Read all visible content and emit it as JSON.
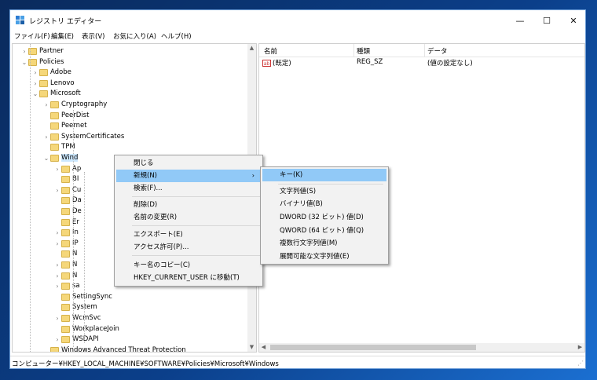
{
  "window": {
    "title": "レジストリ エディター",
    "controls": {
      "minimize": "—",
      "maximize": "☐",
      "close": "✕"
    }
  },
  "menubar": [
    "ファイル(F)",
    "編集(E)",
    "表示(V)",
    "お気に入り(A)",
    "ヘルプ(H)"
  ],
  "tree": [
    {
      "label": "Partner",
      "expander": "›"
    },
    {
      "label": "Policies",
      "expander": "⌄"
    },
    {
      "label": "Adobe",
      "expander": "›"
    },
    {
      "label": "Lenovo",
      "expander": "›"
    },
    {
      "label": "Microsoft",
      "expander": "⌄"
    },
    {
      "label": "Cryptography",
      "expander": "›"
    },
    {
      "label": "PeerDist",
      "expander": ""
    },
    {
      "label": "Peernet",
      "expander": ""
    },
    {
      "label": "SystemCertificates",
      "expander": "›"
    },
    {
      "label": "TPM",
      "expander": ""
    },
    {
      "label": "Wind",
      "expander": "⌄"
    },
    {
      "label": "Ap",
      "expander": "›"
    },
    {
      "label": "BI",
      "expander": ""
    },
    {
      "label": "Cu",
      "expander": "›"
    },
    {
      "label": "Da",
      "expander": ""
    },
    {
      "label": "De",
      "expander": ""
    },
    {
      "label": "Er",
      "expander": ""
    },
    {
      "label": "In",
      "expander": "›"
    },
    {
      "label": "IP",
      "expander": "›"
    },
    {
      "label": "N",
      "expander": ""
    },
    {
      "label": "N",
      "expander": "›"
    },
    {
      "label": "N",
      "expander": "›"
    },
    {
      "label": "sa",
      "expander": "›"
    },
    {
      "label": "SettingSync",
      "expander": ""
    },
    {
      "label": "System",
      "expander": ""
    },
    {
      "label": "WcmSvc",
      "expander": "›"
    },
    {
      "label": "WorkplaceJoin",
      "expander": ""
    },
    {
      "label": "WSDAPI",
      "expander": "›"
    },
    {
      "label": "Windows Advanced Threat Protection",
      "expander": ""
    }
  ],
  "list": {
    "headers": {
      "name": "名前",
      "type": "種類",
      "data": "データ"
    },
    "rows": [
      {
        "icon": "ab",
        "name": "(既定)",
        "type": "REG_SZ",
        "data": "(値の設定なし)"
      }
    ]
  },
  "status": "コンピューター¥HKEY_LOCAL_MACHINE¥SOFTWARE¥Policies¥Microsoft¥Windows",
  "context_menu": {
    "items": [
      "閉じる",
      "新規(N)",
      "検索(F)...",
      "削除(D)",
      "名前の変更(R)",
      "エクスポート(E)",
      "アクセス許可(P)...",
      "キー名のコピー(C)",
      "HKEY_CURRENT_USER に移動(T)"
    ],
    "submenu_arrow": "›"
  },
  "submenu": {
    "items": [
      "キー(K)",
      "文字列値(S)",
      "バイナリ値(B)",
      "DWORD (32 ビット) 値(D)",
      "QWORD (64 ビット) 値(Q)",
      "複数行文字列値(M)",
      "展開可能な文字列値(E)"
    ]
  },
  "scroll_arrows": {
    "up": "▲",
    "down": "▼",
    "left": "◀",
    "right": "▶"
  },
  "grip": "⋰",
  "icon_text": {
    "ab": "ab"
  }
}
